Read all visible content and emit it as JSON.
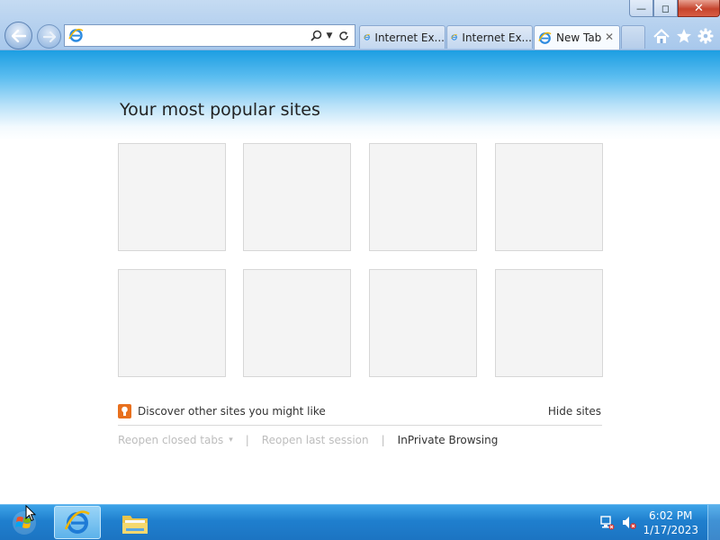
{
  "window": {
    "controls": {
      "minimize": "—",
      "restore": "◻",
      "close": "✕"
    }
  },
  "toolbar": {
    "back_icon": "back-arrow-icon",
    "forward_icon": "forward-arrow-icon",
    "address": {
      "value": "",
      "placeholder": ""
    },
    "address_icons": [
      "search-icon",
      "dropdown-icon",
      "refresh-icon"
    ]
  },
  "tabs": [
    {
      "label": "Internet Ex...",
      "active": false
    },
    {
      "label": "Internet Ex...",
      "active": false
    },
    {
      "label": "New Tab",
      "active": true,
      "close": "✕"
    }
  ],
  "tools": [
    "home-icon",
    "favorites-icon",
    "settings-icon"
  ],
  "page": {
    "heading": "Your most popular sites",
    "tile_count": 8,
    "discover_text": "Discover other sites you might like",
    "hide_sites": "Hide sites",
    "reopen_closed_tabs": "Reopen closed tabs",
    "reopen_closed_tabs_arrow": "▾",
    "separator": "|",
    "reopen_last_session": "Reopen last session",
    "inprivate": "InPrivate Browsing"
  },
  "taskbar": {
    "pinned": [
      "internet-explorer-icon",
      "windows-explorer-icon"
    ],
    "tray": [
      "network-icon",
      "volume-muted-icon"
    ],
    "time": "6:02 PM",
    "date": "1/17/2023"
  },
  "colors": {
    "accent": "#1c9ee2",
    "taskbar": "#1f7fce",
    "discover_icon": "#e8701e"
  }
}
